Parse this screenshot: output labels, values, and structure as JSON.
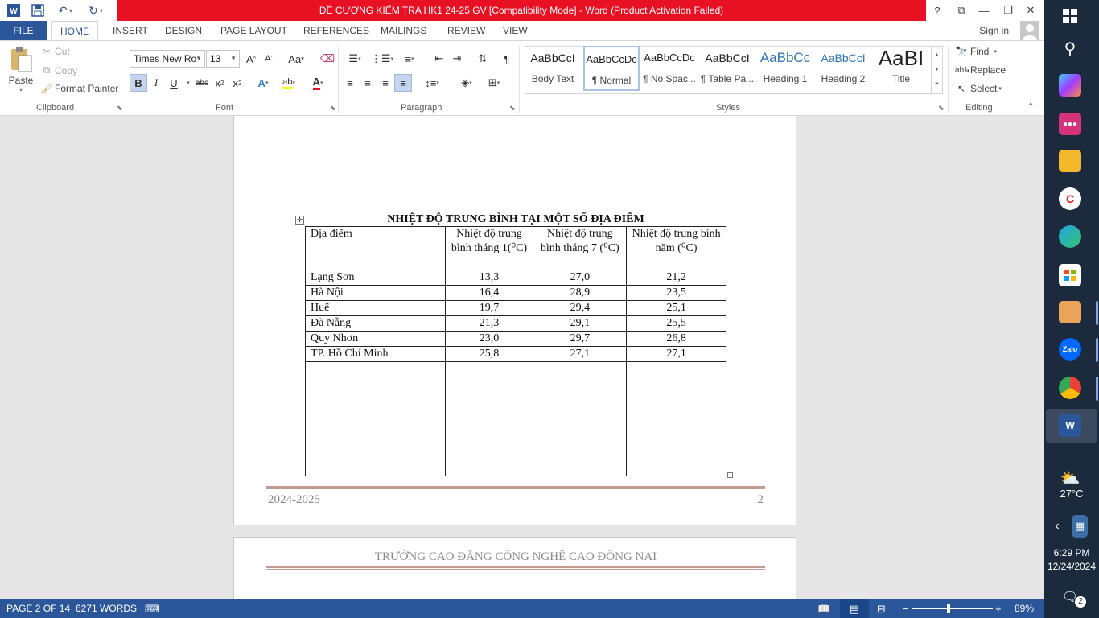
{
  "titlebar": {
    "title": "ĐỀ CƯƠNG KIỂM TRA  HK1 24-25 GV [Compatibility Mode] -  Word (Product Activation Failed)",
    "help": "?",
    "restore_ribbon": "⧉",
    "minimize": "—",
    "maximize": "❐",
    "close": "✕"
  },
  "tabs": {
    "file": "FILE",
    "items": [
      "HOME",
      "INSERT",
      "DESIGN",
      "PAGE LAYOUT",
      "REFERENCES",
      "MAILINGS",
      "REVIEW",
      "VIEW"
    ],
    "active": "HOME",
    "signin": "Sign in"
  },
  "clipboard": {
    "paste": "Paste",
    "cut": "Cut",
    "copy": "Copy",
    "format_painter": "Format Painter",
    "label": "Clipboard"
  },
  "font": {
    "name": "Times New Ro",
    "size": "13",
    "label": "Font"
  },
  "paragraph": {
    "label": "Paragraph"
  },
  "styles": {
    "label": "Styles",
    "items": [
      {
        "sample": "AaBbCcI",
        "name": "Body Text"
      },
      {
        "sample": "AaBbCcDc",
        "name": "¶ Normal"
      },
      {
        "sample": "AaBbCcDc",
        "name": "¶ No Spac..."
      },
      {
        "sample": "AaBbCcI",
        "name": "¶ Table Pa..."
      },
      {
        "sample": "AaBbCc",
        "name": "Heading 1"
      },
      {
        "sample": "AaBbCcI",
        "name": "Heading 2"
      },
      {
        "sample": "AaBI",
        "name": "Title"
      }
    ]
  },
  "editing": {
    "find": "Find",
    "replace": "Replace",
    "select": "Select",
    "label": "Editing"
  },
  "document": {
    "table_title": "NHIỆT ĐỘ TRUNG BÌNH TẠI MỘT SỐ ĐỊA ĐIỂM",
    "headers": [
      "Địa điểm",
      "Nhiệt độ trung bình tháng 1(⁰C)",
      "Nhiệt độ trung bình tháng 7 (⁰C)",
      "Nhiệt độ trung bình năm (⁰C)"
    ],
    "rows": [
      [
        "Lạng Sơn",
        "13,3",
        "27,0",
        "21,2"
      ],
      [
        "Hà Nội",
        "16,4",
        "28,9",
        "23,5"
      ],
      [
        "Huế",
        "19,7",
        "29,4",
        "25,1"
      ],
      [
        "Đà Nẵng",
        "21,3",
        "29,1",
        "25,5"
      ],
      [
        "Quy Nhơn",
        "23,0",
        "29,7",
        "26,8"
      ],
      [
        "TP. Hồ Chí Minh",
        "25,8",
        "27,1",
        "27,1"
      ]
    ],
    "footer_left": "2024-2025",
    "footer_right": "2",
    "next_header": "TRƯỜNG CAO ĐẲNG CÔNG NGHỆ CAO ĐỒNG NAI"
  },
  "status": {
    "page": "PAGE 2 OF 14",
    "words": "6271 WORDS",
    "zoom": "89%"
  },
  "taskbar": {
    "weather_temp": "27°C",
    "time": "6:29 PM",
    "date": "12/24/2024",
    "notifications": "2"
  },
  "colors": {
    "brand": "#2b579a",
    "activation_bar": "#e81123",
    "taskbar": "#1c2a3d"
  }
}
